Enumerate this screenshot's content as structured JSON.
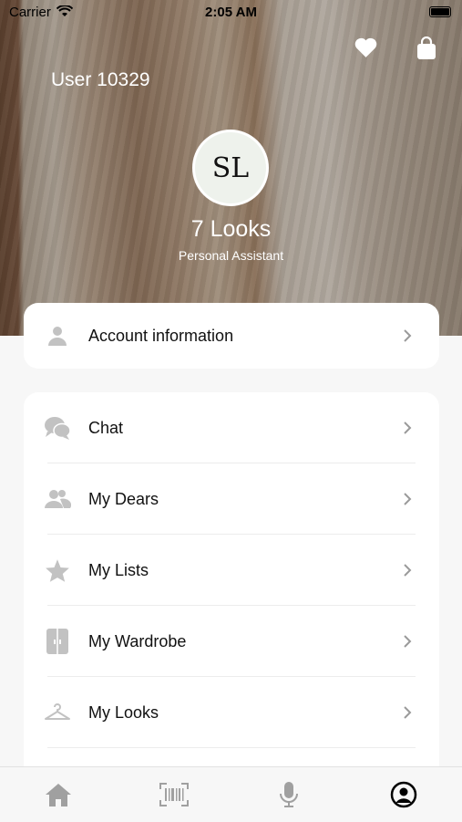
{
  "status": {
    "carrier": "Carrier",
    "time": "2:05 AM"
  },
  "header": {
    "user_name": "User 10329",
    "logo_text": "SL",
    "brand": "7 Looks",
    "subtitle": "Personal Assistant"
  },
  "account": {
    "label": "Account information"
  },
  "menu": [
    {
      "label": "Chat",
      "icon": "chat-icon"
    },
    {
      "label": "My Dears",
      "icon": "people-icon"
    },
    {
      "label": "My Lists",
      "icon": "star-icon"
    },
    {
      "label": "My Wardrobe",
      "icon": "wardrobe-icon"
    },
    {
      "label": "My Looks",
      "icon": "hanger-icon"
    }
  ],
  "tabbar": [
    "home-icon",
    "barcode-scan-icon",
    "microphone-icon",
    "profile-icon"
  ],
  "colors": {
    "icon_gray": "#c2c2c2",
    "chevron": "#9a9a9a",
    "text": "#111111",
    "background": "#f7f7f7"
  }
}
